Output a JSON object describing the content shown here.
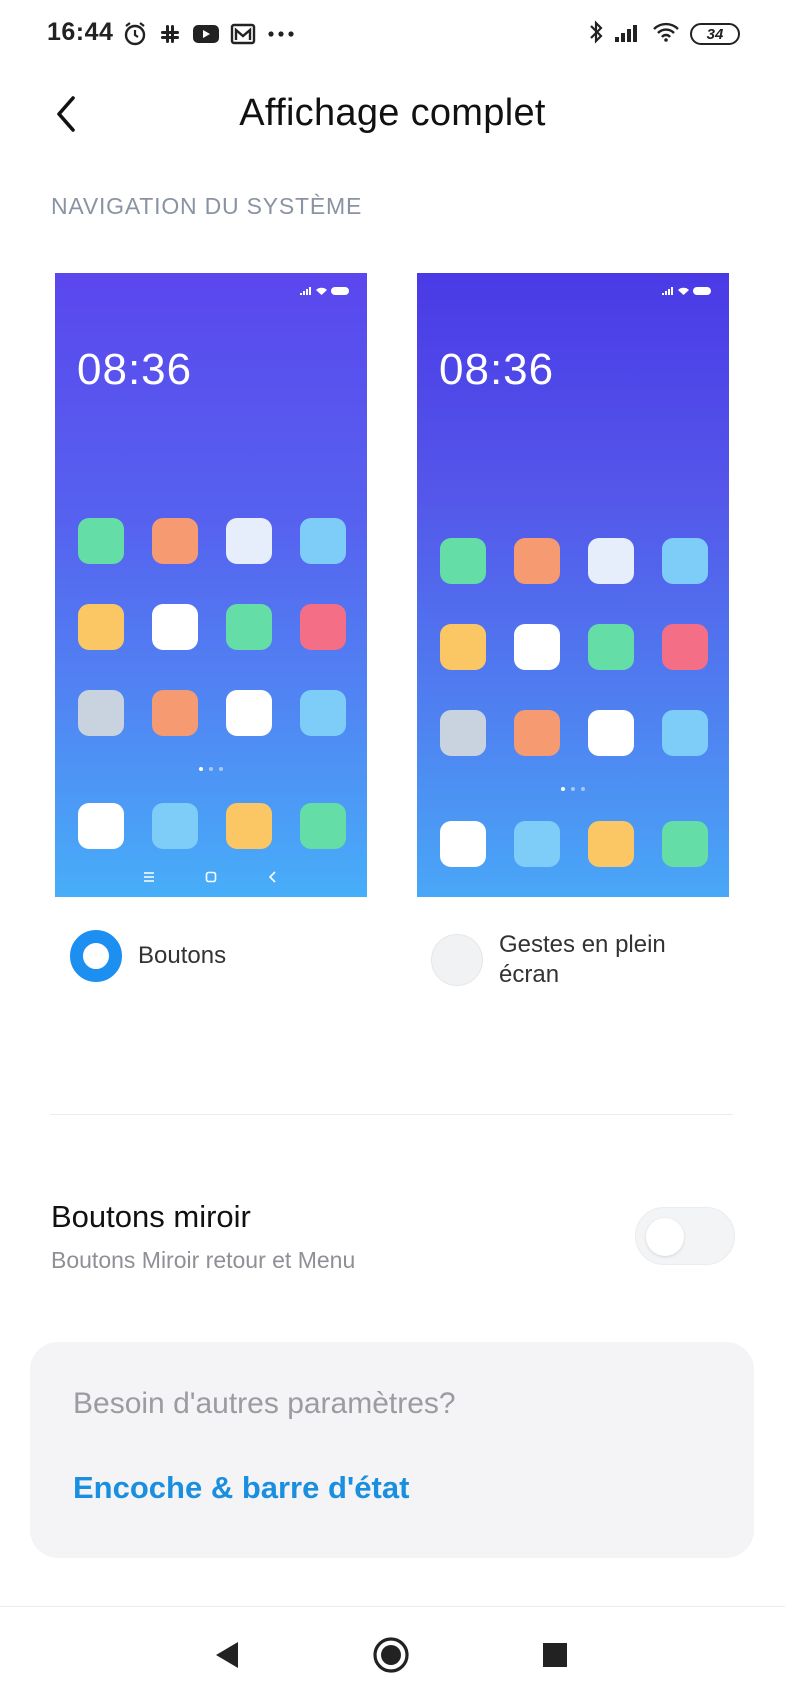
{
  "status_bar": {
    "time": "16:44",
    "battery": "34",
    "left_icons": [
      "alarm-icon",
      "slack-icon",
      "youtube-icon",
      "gmail-icon",
      "more-icon"
    ],
    "right_icons": [
      "bluetooth-icon",
      "signal-icon",
      "wifi-icon",
      "battery-icon"
    ]
  },
  "header": {
    "title": "Affichage complet",
    "back_icon": "chevron-left-icon"
  },
  "section": {
    "label": "NAVIGATION DU SYSTÈME"
  },
  "previews": {
    "left": {
      "time": "08:36",
      "mode": "buttons"
    },
    "right": {
      "time": "08:36",
      "mode": "gestures"
    },
    "app_colors": [
      [
        "#64dda6",
        "#f69a72",
        "#e6eefb",
        "#7dcdf8"
      ],
      [
        "#fbc764",
        "#ffffff",
        "#64dda6",
        "#f46f86"
      ],
      [
        "#c9d3df",
        "#f69a72",
        "#ffffff",
        "#7dcdf8"
      ]
    ],
    "dock_colors": [
      "#ffffff",
      "#7dcdf8",
      "#fbc764",
      "#64dda6"
    ]
  },
  "options": {
    "buttons": {
      "label": "Boutons",
      "selected": true
    },
    "gestures": {
      "label": "Gestes en plein écran",
      "selected": false
    }
  },
  "mirror": {
    "title": "Boutons miroir",
    "subtitle": "Boutons Miroir retour et Menu",
    "enabled": false
  },
  "card": {
    "label": "Besoin d'autres paramètres?",
    "link": "Encoche & barre d'état"
  },
  "colors": {
    "accent": "#1d8ff0",
    "link": "#1a8fe0"
  },
  "navbar": {
    "icons": [
      "back-triangle-icon",
      "home-circle-icon",
      "recents-square-icon"
    ]
  }
}
